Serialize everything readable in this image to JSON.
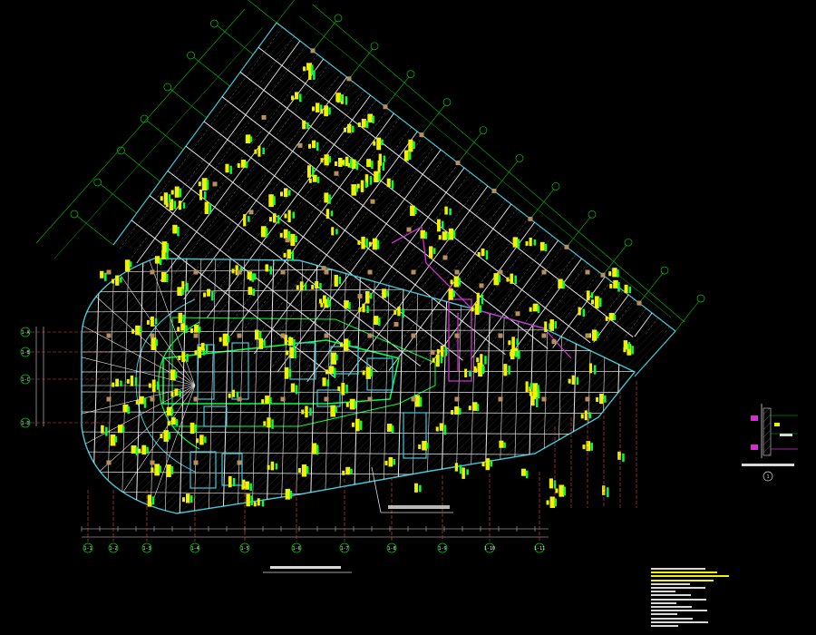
{
  "drawing": {
    "plan_title": "...",
    "callout_text": "...",
    "detail_title": "...",
    "detail_number": "1"
  },
  "colors": {
    "background": "#000000",
    "grid_line": "#00c800",
    "dimension_line": "#d8d8d8",
    "grid_line_dashed": "#e04848",
    "wall_cyan": "#40c8d8",
    "hatch": "#8a8a8a",
    "column": "#b89060",
    "annotation_yellow": "#f2f200",
    "annotation_green": "#00ff40",
    "magenta": "#d030d0",
    "beam_white": "#e8e8e8"
  },
  "bottom_axis_labels": [
    "1-1",
    "1-2",
    "1-3",
    "1-4",
    "1-5",
    "1-6",
    "1-7",
    "1-8",
    "1-9",
    "1-10",
    "1-11"
  ],
  "left_axis_labels": [
    "1-A",
    "1-B",
    "1-C",
    "1-D"
  ]
}
